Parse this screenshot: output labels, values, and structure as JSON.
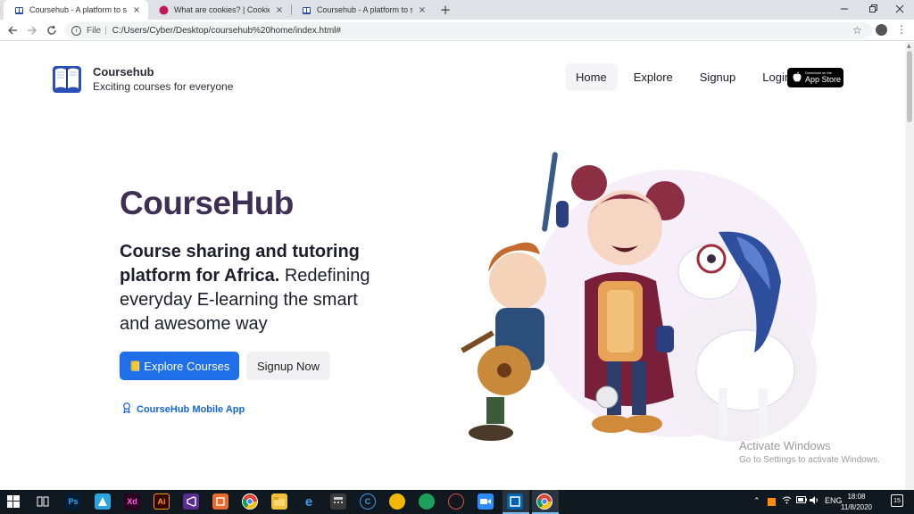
{
  "browser": {
    "tabs": [
      {
        "title": "Coursehub - A platform to share",
        "icon": "book-icon",
        "active": true
      },
      {
        "title": "What are cookies? | Cookies & Yo",
        "icon": "site-icon",
        "active": false
      },
      {
        "title": "Coursehub - A platform to share",
        "icon": "book-icon",
        "active": false
      }
    ],
    "close_glyph": "×",
    "new_tab_glyph": "+",
    "file_label": "File",
    "url": "C:/Users/Cyber/Desktop/coursehub%20home/index.html#"
  },
  "site": {
    "brand_name": "Coursehub",
    "tagline": "Exciting courses for everyone",
    "nav": [
      "Home",
      "Explore",
      "Signup",
      "Login"
    ],
    "appstore_small": "Download on the",
    "appstore_big": "App Store"
  },
  "hero": {
    "title": "CourseHub",
    "desc_bold": "Course sharing and tutoring platform for Africa.",
    "desc_rest": " Redefining everyday E-learning the smart and awesome way",
    "explore_emoji": "📒",
    "explore_label": "Explore Courses",
    "signup_label": "Signup Now",
    "mobile_link_label": "CourseHub Mobile App"
  },
  "watermark": {
    "line1": "Activate Windows",
    "line2": "Go to Settings to activate Windows."
  },
  "taskbar": {
    "apps": [
      "Ps",
      "Ai",
      "Xd"
    ],
    "language": "ENG",
    "time": "18:08",
    "date": "11/8/2020",
    "notifications": "15"
  },
  "colors": {
    "primary": "#1e6fe8",
    "title": "#3e2f55",
    "link": "#1565d8"
  }
}
